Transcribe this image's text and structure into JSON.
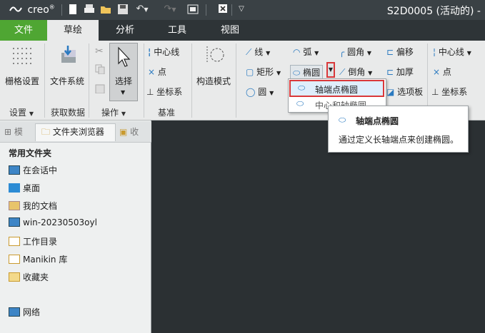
{
  "app": {
    "logo": "creo",
    "title": "S2D0005 (活动的) -"
  },
  "tabs": [
    "文件",
    "草绘",
    "分析",
    "工具",
    "视图"
  ],
  "ribbon": {
    "setup": {
      "grid_label": "栅格设置",
      "group_label": "设置"
    },
    "get_data": {
      "file_system_label": "文件系统",
      "group_label": "获取数据"
    },
    "operations": {
      "select_label": "选择",
      "group_label": "操作"
    },
    "datum": {
      "centerline_label": "中心线",
      "point_label": "点",
      "coordsys_label": "坐标系",
      "group_label": "基准"
    },
    "construction": {
      "label": "构造模式"
    },
    "sketching": {
      "line": "线",
      "arc": "弧",
      "fillet": "圆角",
      "offset": "偏移",
      "rectangle": "矩形",
      "ellipse": "椭圆",
      "chamfer": "倒角",
      "thicken": "加厚",
      "circle": "圆",
      "palette": "选项板",
      "centerline": "中心线",
      "point": "点",
      "coordsys": "坐标系"
    }
  },
  "dropdown": {
    "item1": "轴端点椭圆",
    "item2": "中心和轴椭圆"
  },
  "tooltip": {
    "title": "轴端点椭圆",
    "description": "通过定义长轴端点来创建椭圆。"
  },
  "left_panel": {
    "tabs": [
      "模",
      "文件夹浏览器",
      "收"
    ],
    "heading": "常用文件夹",
    "folders": [
      "在会话中",
      "桌面",
      "我的文档",
      "win-20230503oyl",
      "工作目录",
      "Manikin 库",
      "收藏夹",
      "网络"
    ]
  },
  "colors": {
    "accent_green": "#4fa633",
    "highlight_red": "#d9383a",
    "dark_bg": "#2b3033"
  }
}
